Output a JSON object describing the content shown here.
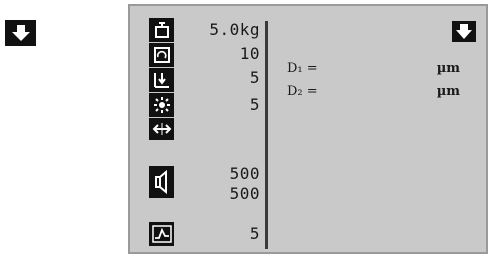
{
  "icons": {
    "external_arrow": "arrow-down-icon",
    "panel_arrow": "arrow-down-icon",
    "load": "weight-icon",
    "rotation": "rotate-icon",
    "indent": "indenter-icon",
    "light": "light-icon",
    "horizontal": "horizontal-arrows-icon",
    "sound": "speaker-icon",
    "graph": "graph-icon"
  },
  "parameters": {
    "load": "5.0kg",
    "rotation": "10",
    "indent": "5",
    "light": "5",
    "sound_1": "500",
    "sound_2": "500",
    "graph": "5"
  },
  "measurements": [
    {
      "label": "D₁ =",
      "unit": "µm"
    },
    {
      "label": "D₂ =",
      "unit": "µm"
    }
  ]
}
